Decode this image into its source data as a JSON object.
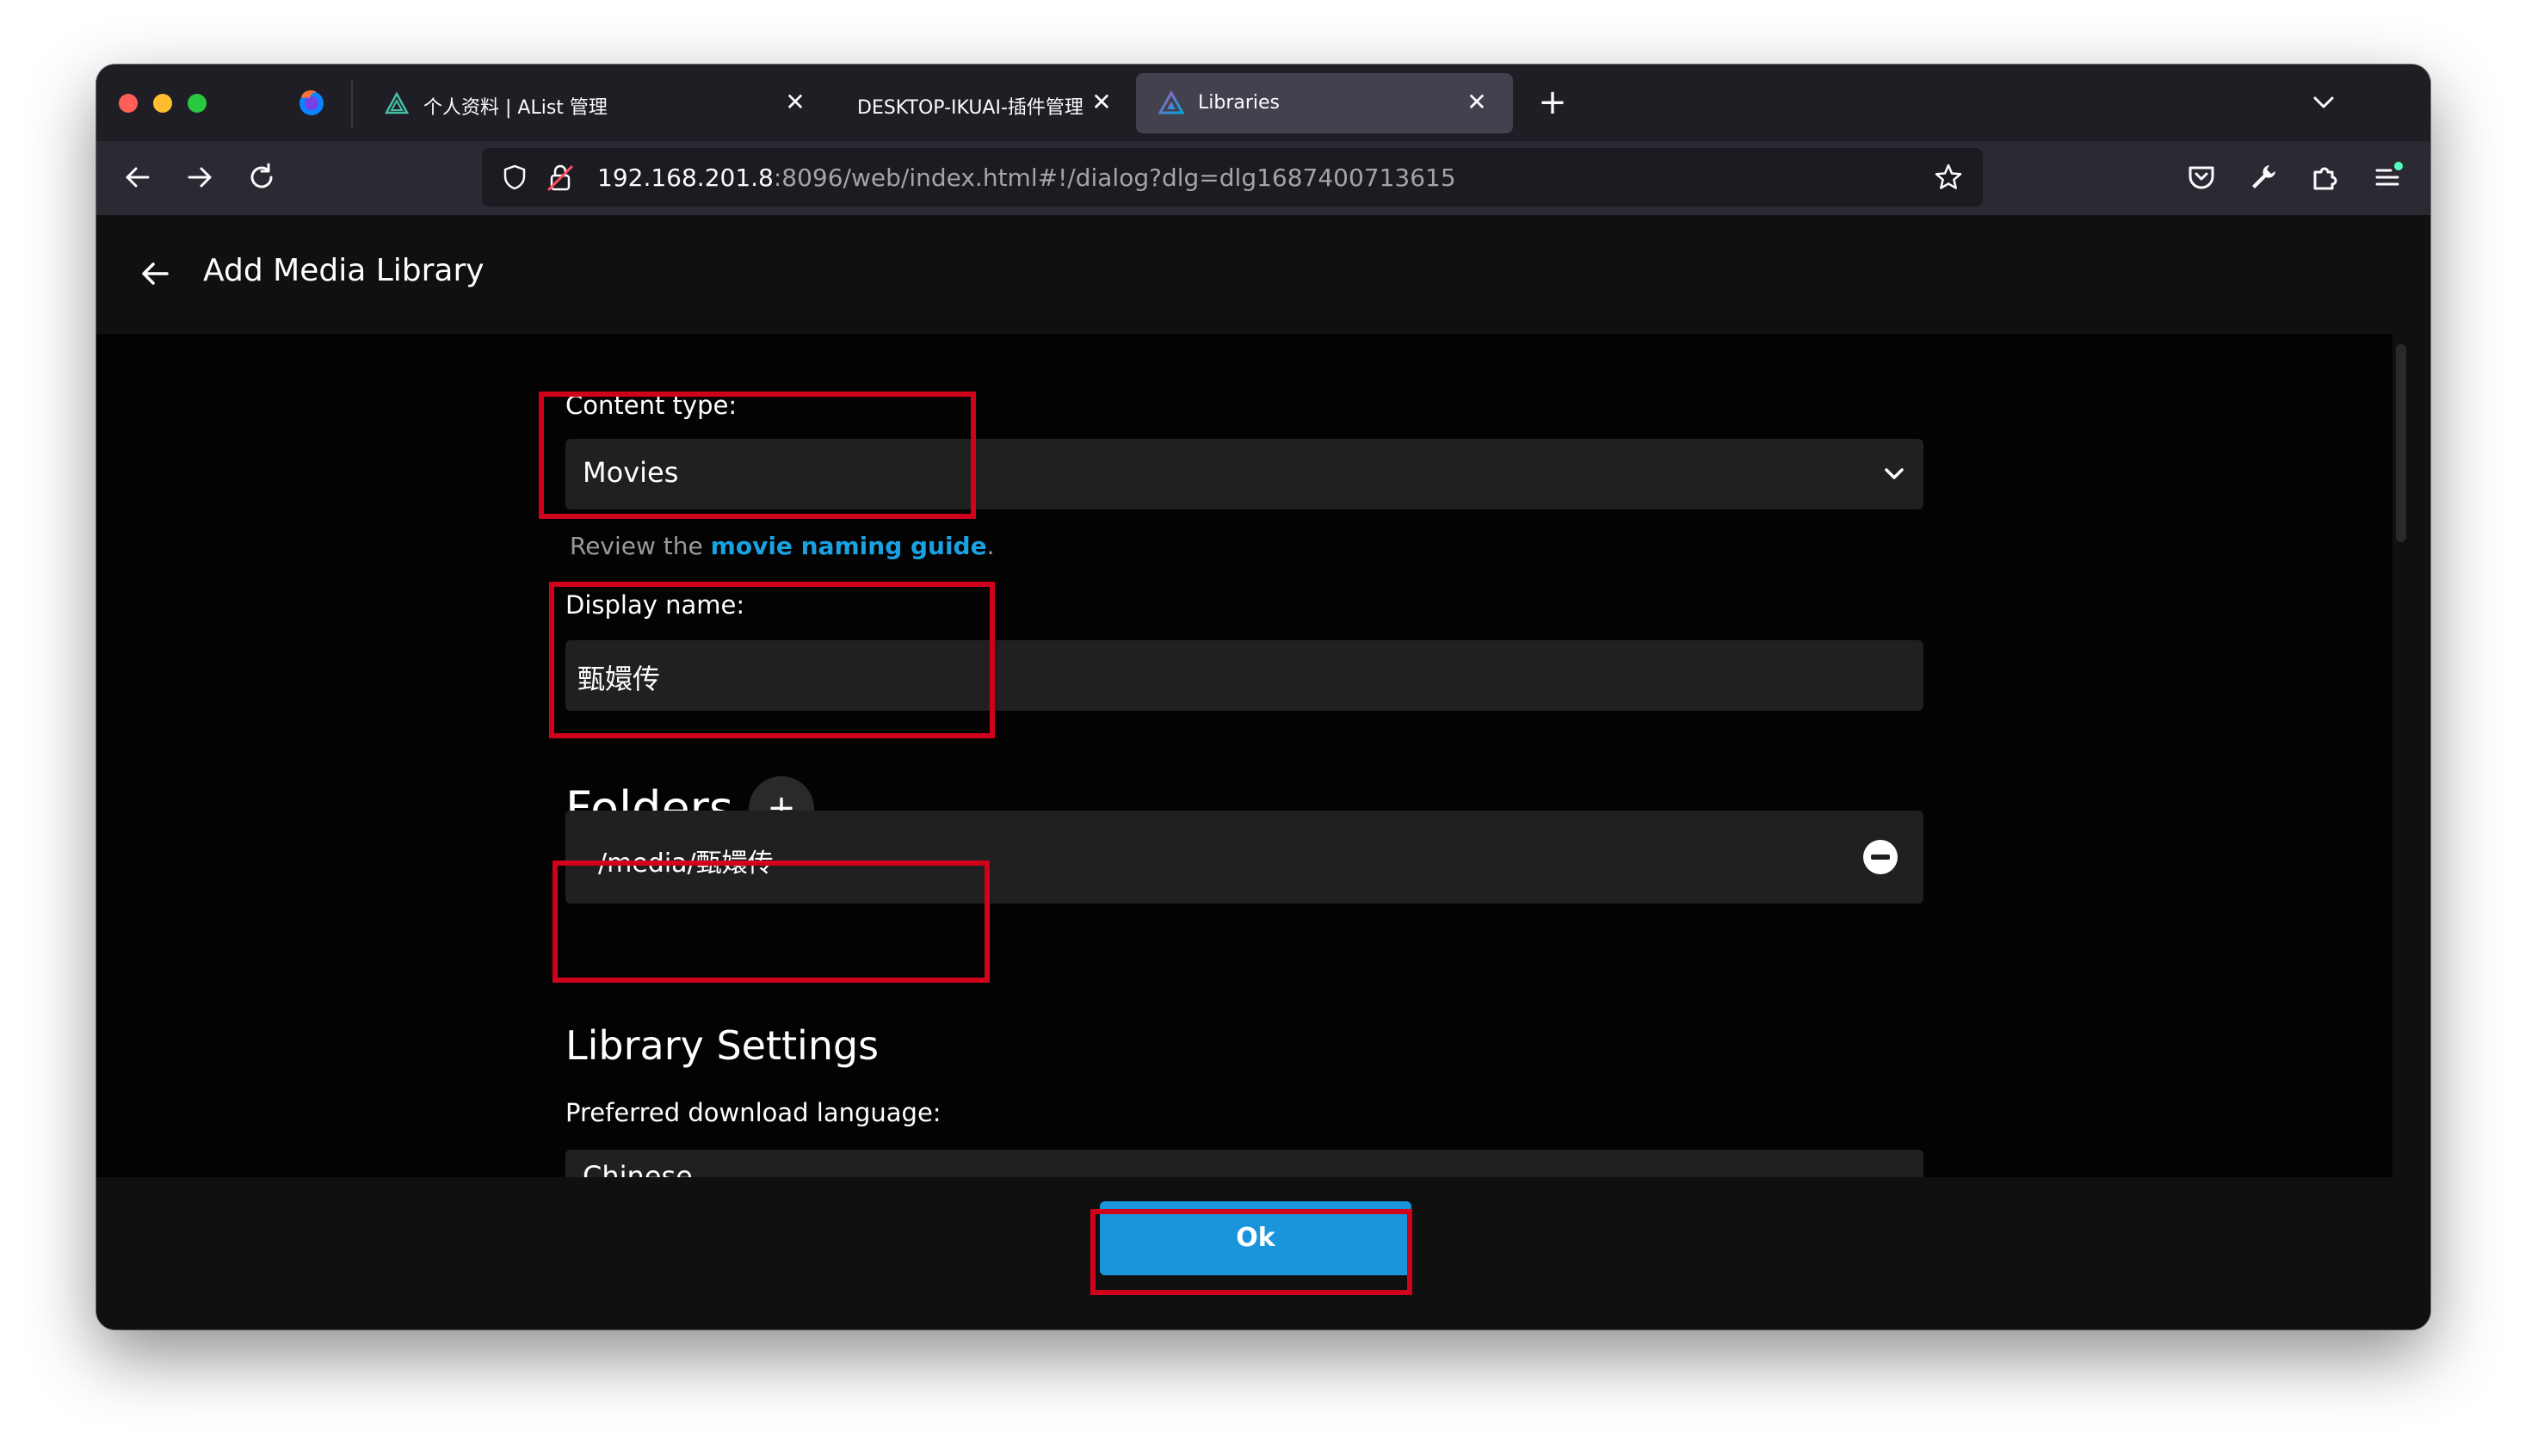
{
  "browser": {
    "tabs": [
      {
        "title": "个人资料 | AList 管理",
        "active": false
      },
      {
        "title": "DESKTOP-IKUAI-插件管理",
        "active": false
      },
      {
        "title": "Libraries",
        "active": true
      }
    ],
    "new_tab_symbol": "+",
    "url_host": "192.168.201.8",
    "url_rest": ":8096/web/index.html#!/dialog?dlg=dlg1687400713615"
  },
  "page": {
    "title": "Add Media Library",
    "content_type": {
      "label": "Content type:",
      "value": "Movies",
      "hint_prefix": "Review the ",
      "hint_link": "movie naming guide",
      "hint_suffix": "."
    },
    "display_name": {
      "label": "Display name:",
      "value": "甄嬛传"
    },
    "folders": {
      "title": "Folders",
      "add_symbol": "+",
      "items": [
        {
          "path": "/media/甄嬛传"
        }
      ]
    },
    "library_settings": {
      "title": "Library Settings",
      "preferred_language_label": "Preferred download language:",
      "preferred_language_value": "Chinese"
    },
    "ok_label": "Ok"
  },
  "colors": {
    "annotation": "#d0021b",
    "ok_button": "#1a95dc",
    "link": "#1aa1e1"
  },
  "icons": [
    "firefox-icon",
    "alist-icon",
    "jellyfin-icon",
    "close-icon",
    "back-icon",
    "forward-icon",
    "reload-icon",
    "shield-icon",
    "lock-icon",
    "star-icon",
    "pocket-icon",
    "wrench-icon",
    "extensions-icon",
    "menu-icon",
    "chevron-down-icon",
    "minus-circle-icon",
    "plus-icon"
  ]
}
